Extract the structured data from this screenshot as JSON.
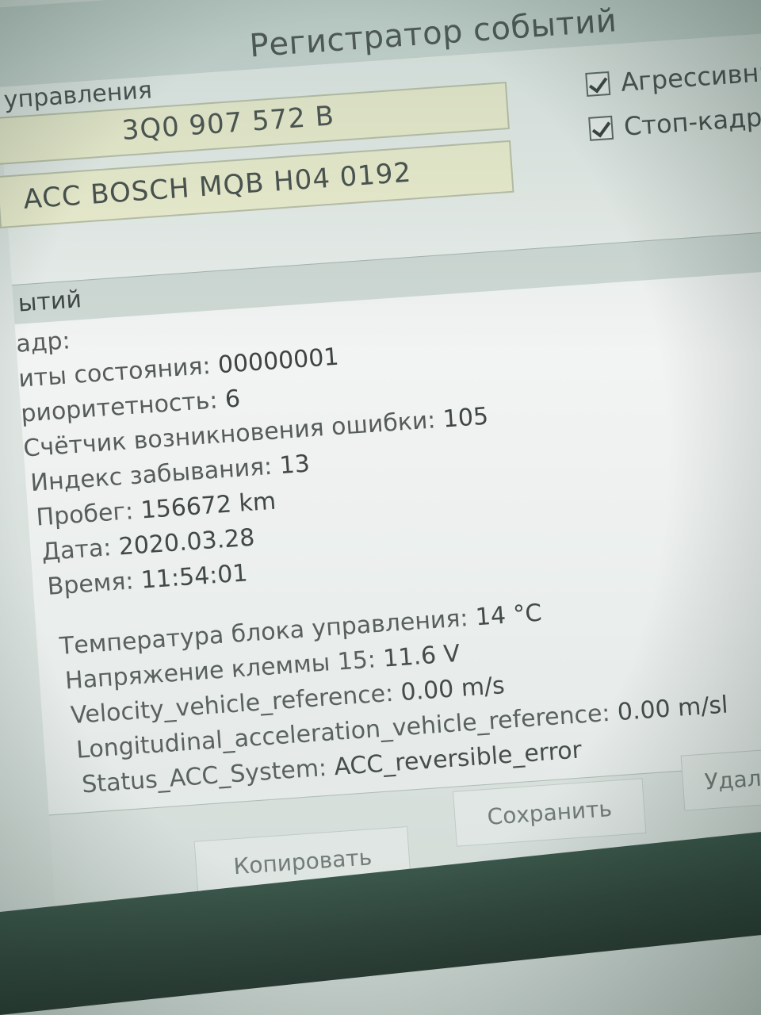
{
  "window": {
    "title": "Регистратор событий"
  },
  "control_unit": {
    "group_label": "управления",
    "part_number": "3Q0 907 572 B",
    "component": "ACC BOSCH MQB H04 0192"
  },
  "options": {
    "aggressive_label": "Агрессивны",
    "freeze_frame_label": "Стоп-кадр"
  },
  "events": {
    "section_label": "ытий",
    "freeze_frame_heading": "адр:",
    "status_bits": {
      "label": "иты состояния:",
      "value": "00000001"
    },
    "priority": {
      "label": "риоритетность:",
      "value": "6"
    },
    "error_counter": {
      "label": "Счётчик возникновения ошибки:",
      "value": "105"
    },
    "forget_index": {
      "label": "Индекс забывания:",
      "value": "13"
    },
    "mileage": {
      "label": "Пробег:",
      "value": "156672 km"
    },
    "date": {
      "label": "Дата:",
      "value": "2020.03.28"
    },
    "time": {
      "label": "Время:",
      "value": "11:54:01"
    },
    "ecu_temp": {
      "label": "Температура блока управления:",
      "value": "14 °C"
    },
    "terminal_voltage": {
      "label": "Напряжение клеммы 15:",
      "value": "11.6 V"
    },
    "velocity": {
      "label": "Velocity_vehicle_reference:",
      "value": "0.00 m/s"
    },
    "long_accel": {
      "label": "Longitudinal_acceleration_vehicle_reference:",
      "value": "0.00 m/sl"
    },
    "acc_status": {
      "label": "Status_ACC_System:",
      "value": "ACC_reversible_error"
    }
  },
  "buttons": {
    "copy": "Копировать",
    "save": "Сохранить",
    "delete": "Удалить со"
  }
}
